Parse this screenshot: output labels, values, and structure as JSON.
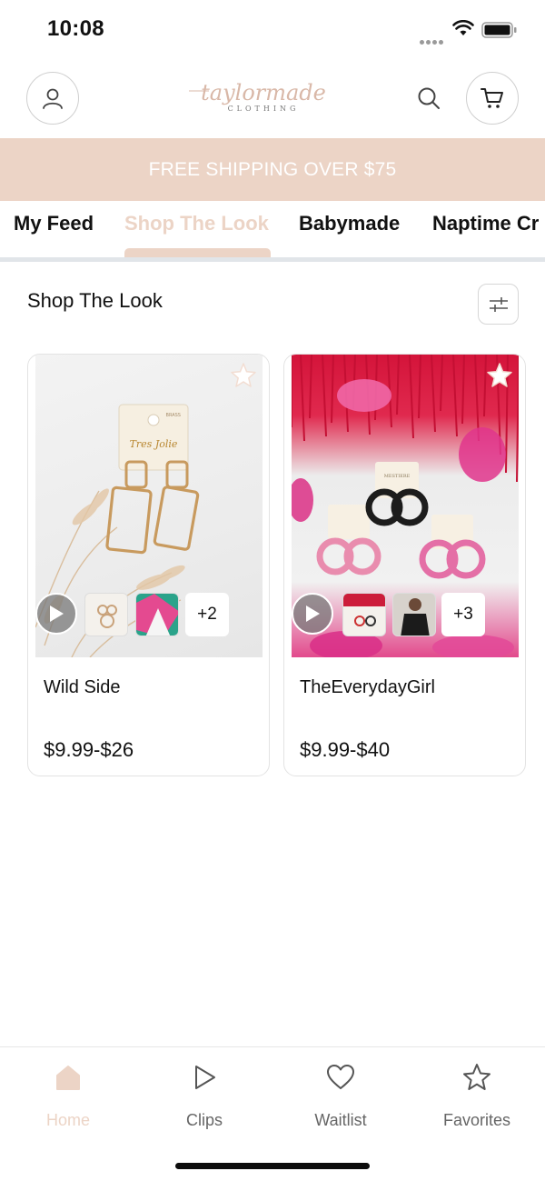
{
  "status_bar": {
    "time": "10:08"
  },
  "header": {
    "logo_script": "taylormade",
    "logo_caption": "CLOTHING"
  },
  "promo": {
    "text": "FREE SHIPPING OVER $75"
  },
  "tabs": [
    {
      "label": "My Feed",
      "active": false
    },
    {
      "label": "Shop The Look",
      "active": true
    },
    {
      "label": "Babymade",
      "active": false
    },
    {
      "label": "Naptime Cr",
      "active": false
    }
  ],
  "section": {
    "title": "Shop The Look"
  },
  "products": [
    {
      "name": "Wild Side",
      "price": "$9.99-$26",
      "more_count": "+2",
      "brand_card_text": "Tres Jolie",
      "brand_card_corner": "BRASS"
    },
    {
      "name": "TheEverydayGirl",
      "price": "$9.99-$40",
      "more_count": "+3",
      "brand_card_text": "MESTIERE"
    }
  ],
  "bottom_nav": [
    {
      "label": "Home",
      "icon": "home-icon",
      "active": true
    },
    {
      "label": "Clips",
      "icon": "play-icon",
      "active": false
    },
    {
      "label": "Waitlist",
      "icon": "heart-icon",
      "active": false
    },
    {
      "label": "Favorites",
      "icon": "star-icon",
      "active": false
    }
  ],
  "colors": {
    "accent": "#ecd4c6",
    "divider": "#e1e5e9",
    "text": "#111111"
  }
}
